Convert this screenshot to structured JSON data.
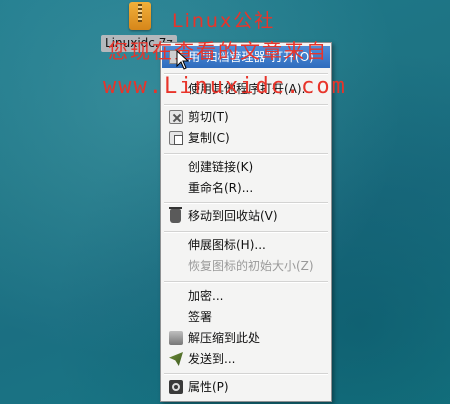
{
  "watermark": {
    "line1": "Linux公社",
    "line2": "您现在查看的文章来自",
    "line3": "www.Linuxidc.com"
  },
  "desktop": {
    "file_label": "Linuxidc.7z",
    "file_icon": "archive-icon"
  },
  "menu": {
    "items": [
      {
        "label": "用\"归档管理器\"打开(O)",
        "icon": "archive-manager-icon",
        "state": "highlighted"
      },
      {
        "label": "使用其他程序打开(A)...",
        "icon": "",
        "state": "normal"
      },
      {
        "label": "剪切(T)",
        "icon": "cut-icon",
        "state": "normal"
      },
      {
        "label": "复制(C)",
        "icon": "copy-icon",
        "state": "normal"
      },
      {
        "label": "创建链接(K)",
        "icon": "",
        "state": "normal"
      },
      {
        "label": "重命名(R)...",
        "icon": "",
        "state": "normal"
      },
      {
        "label": "移动到回收站(V)",
        "icon": "trash-icon",
        "state": "normal"
      },
      {
        "label": "伸展图标(H)...",
        "icon": "",
        "state": "normal"
      },
      {
        "label": "恢复图标的初始大小(Z)",
        "icon": "",
        "state": "disabled"
      },
      {
        "label": "加密...",
        "icon": "",
        "state": "normal"
      },
      {
        "label": "签署",
        "icon": "",
        "state": "normal"
      },
      {
        "label": "解压缩到此处",
        "icon": "extract-icon",
        "state": "normal"
      },
      {
        "label": "发送到...",
        "icon": "send-icon",
        "state": "normal"
      },
      {
        "label": "属性(P)",
        "icon": "properties-icon",
        "state": "normal"
      }
    ]
  },
  "colors": {
    "highlight": "#3a78cc",
    "watermark": "#e8342a",
    "desktop": "#1e7484"
  }
}
